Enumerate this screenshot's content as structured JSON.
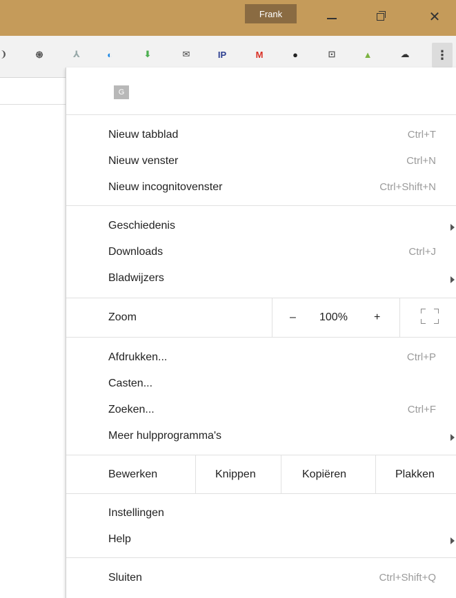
{
  "window": {
    "user_name": "Frank",
    "minimize_icon": "minimize-icon",
    "restore_icon": "restore-icon",
    "close_glyph": "✕"
  },
  "toolbar": {
    "extensions": [
      {
        "name": "partial-icon",
        "glyph": "❩",
        "color": "#555"
      },
      {
        "name": "spiral-extension-icon",
        "glyph": "֍",
        "color": "#555"
      },
      {
        "name": "pdf-extension-icon",
        "glyph": "⅄",
        "color": "#9aa"
      },
      {
        "name": "compass-extension-icon",
        "glyph": "◐",
        "color": "#1e88e5"
      },
      {
        "name": "download-extension-icon",
        "glyph": "⬇",
        "color": "#4caf50"
      },
      {
        "name": "mail-check-extension-icon",
        "glyph": "✉",
        "color": "#444"
      },
      {
        "name": "ip-extension-icon",
        "glyph": "IP",
        "color": "#2c3e90"
      },
      {
        "name": "gmail-extension-icon",
        "glyph": "M",
        "color": "#d93025"
      },
      {
        "name": "color-wheel-extension-icon",
        "glyph": "●",
        "color": "#222"
      },
      {
        "name": "cast-extension-icon",
        "glyph": "⊡",
        "color": "#555"
      },
      {
        "name": "bag-extension-icon",
        "glyph": "▲",
        "color": "#7cb342"
      },
      {
        "name": "cloud-extension-icon",
        "glyph": "☁",
        "color": "#333"
      }
    ],
    "menu_glyph": "⋮"
  },
  "menu": {
    "account_badge": "G",
    "new_tab": {
      "label": "Nieuw tabblad",
      "shortcut": "Ctrl+T"
    },
    "new_window": {
      "label": "Nieuw venster",
      "shortcut": "Ctrl+N"
    },
    "new_incognito": {
      "label": "Nieuw incognitovenster",
      "shortcut": "Ctrl+Shift+N"
    },
    "history": {
      "label": "Geschiedenis"
    },
    "downloads": {
      "label": "Downloads",
      "shortcut": "Ctrl+J"
    },
    "bookmarks": {
      "label": "Bladwijzers"
    },
    "zoom": {
      "label": "Zoom",
      "minus": "–",
      "value": "100%",
      "plus": "+"
    },
    "print": {
      "label": "Afdrukken...",
      "shortcut": "Ctrl+P"
    },
    "cast": {
      "label": "Casten..."
    },
    "find": {
      "label": "Zoeken...",
      "shortcut": "Ctrl+F"
    },
    "more_tools": {
      "label": "Meer hulpprogramma's"
    },
    "edit": {
      "label": "Bewerken",
      "cut": "Knippen",
      "copy": "Kopiëren",
      "paste": "Plakken"
    },
    "settings": {
      "label": "Instellingen"
    },
    "help": {
      "label": "Help"
    },
    "exit": {
      "label": "Sluiten",
      "shortcut": "Ctrl+Shift+Q"
    }
  }
}
